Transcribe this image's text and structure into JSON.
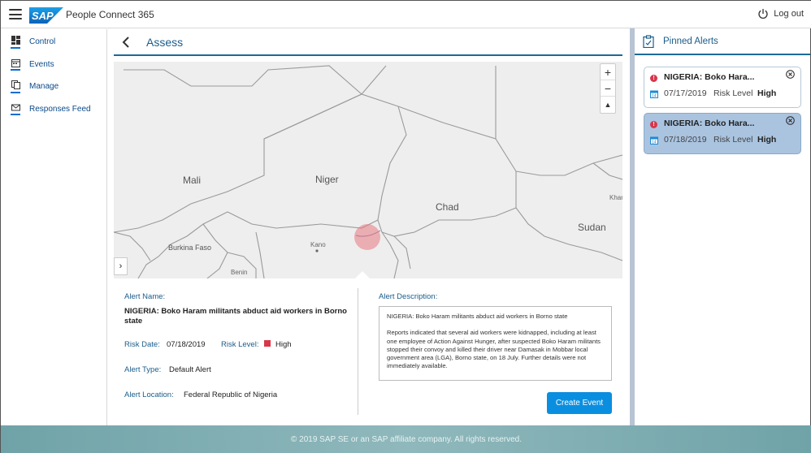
{
  "header": {
    "logo_text": "SAP",
    "app_title": "People Connect 365",
    "logout_label": "Log out"
  },
  "sidebar": {
    "items": [
      {
        "label": "Control",
        "icon": "dashboard-icon"
      },
      {
        "label": "Events",
        "icon": "calendar-icon"
      },
      {
        "label": "Manage",
        "icon": "documents-icon"
      },
      {
        "label": "Responses Feed",
        "icon": "envelope-icon"
      }
    ]
  },
  "main": {
    "title": "Assess",
    "map": {
      "labels": {
        "mali": "Mali",
        "niger": "Niger",
        "chad": "Chad",
        "sudan": "Sudan",
        "burkina_faso": "Burkina Faso",
        "kano": "Kano",
        "benin": "Benin",
        "khartoum": "Khar"
      },
      "zoom_in": "+",
      "zoom_out": "−",
      "reset": "▲",
      "expand": "›"
    },
    "alert": {
      "name_label": "Alert Name:",
      "name": "NIGERIA: Boko Haram militants abduct aid workers in Borno state",
      "risk_date_label": "Risk Date:",
      "risk_date": "07/18/2019",
      "risk_level_label": "Risk Level:",
      "risk_level": "High",
      "risk_color": "#d9364a",
      "type_label": "Alert Type:",
      "type": "Default Alert",
      "location_label": "Alert Location:",
      "location": "Federal Republic of Nigeria",
      "description_label": "Alert Description:",
      "description_title": "NIGERIA: Boko Haram militants abduct aid workers in Borno state",
      "description_body": "Reports indicated that several aid workers were kidnapped, including at least one employee of Action Against Hunger, after suspected Boko Haram militants stopped their convoy and killed their driver near Damasak in Mobbar local government area (LGA), Borno state, on 18 July. Further details were not immediately available.",
      "create_button": "Create Event"
    }
  },
  "pinned": {
    "title": "Pinned Alerts",
    "cards": [
      {
        "title": "NIGERIA: Boko Hara...",
        "date": "07/17/2019",
        "risk_label": "Risk Level",
        "risk": "High",
        "selected": false
      },
      {
        "title": "NIGERIA: Boko Hara...",
        "date": "07/18/2019",
        "risk_label": "Risk Level",
        "risk": "High",
        "selected": true
      }
    ]
  },
  "footer": {
    "text": "© 2019 SAP SE or an SAP affiliate company. All rights reserved."
  },
  "colors": {
    "accent": "#1a5c8a",
    "button": "#0a8fe0",
    "selected_card": "#aac4e0"
  }
}
